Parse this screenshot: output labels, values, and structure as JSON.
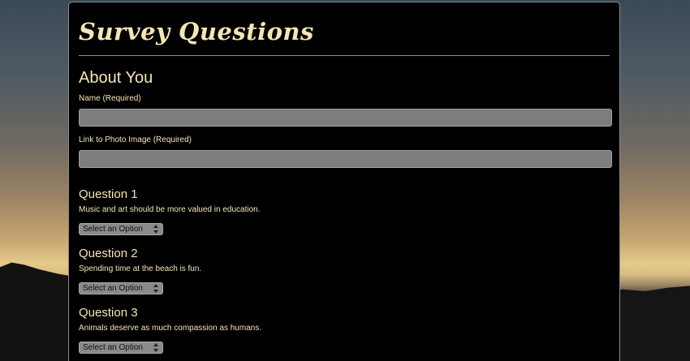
{
  "page": {
    "title": "Survey Questions"
  },
  "about": {
    "heading": "About You",
    "name_label": "Name (Required)",
    "name_value": "",
    "photo_label": "Link to Photo Image (Required)",
    "photo_value": ""
  },
  "questions": [
    {
      "title": "Question 1",
      "text": "Music and art should be more valued in education.",
      "selected": "Select an Option"
    },
    {
      "title": "Question 2",
      "text": "Spending time at the beach is fun.",
      "selected": "Select an Option"
    },
    {
      "title": "Question 3",
      "text": "Animals deserve as much compassion as humans.",
      "selected": "Select an Option"
    }
  ],
  "colors": {
    "text": "#f4e6b4",
    "panel": "#000000",
    "input": "#7d7d7d"
  },
  "icons": {
    "select_arrow": "up-down-chevron-icon"
  }
}
